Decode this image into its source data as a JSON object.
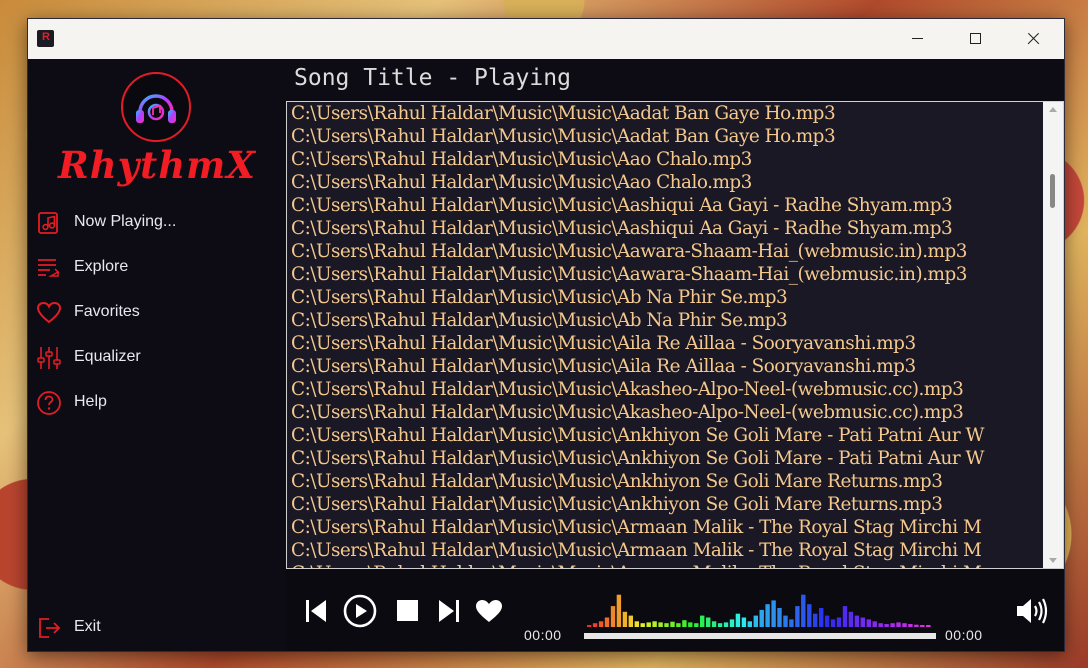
{
  "titlebar": {
    "minimize_glyph": "minimize",
    "maximize_glyph": "maximize",
    "close_glyph": "close"
  },
  "sidebar": {
    "logo_text": "RhythmX",
    "items": [
      {
        "label": "Now Playing...",
        "icon": "music-note-doc-icon"
      },
      {
        "label": "Explore",
        "icon": "playlist-icon"
      },
      {
        "label": "Favorites",
        "icon": "heart-icon"
      },
      {
        "label": "Equalizer",
        "icon": "sliders-icon"
      },
      {
        "label": "Help",
        "icon": "help-icon"
      }
    ],
    "exit_label": "Exit"
  },
  "main": {
    "title": "Song Title - Playing",
    "tracks": [
      "C:\\Users\\Rahul Haldar\\Music\\Music\\Aadat Ban Gaye Ho.mp3",
      "C:\\Users\\Rahul Haldar\\Music\\Music\\Aadat Ban Gaye Ho.mp3",
      "C:\\Users\\Rahul Haldar\\Music\\Music\\Aao Chalo.mp3",
      "C:\\Users\\Rahul Haldar\\Music\\Music\\Aao Chalo.mp3",
      "C:\\Users\\Rahul Haldar\\Music\\Music\\Aashiqui Aa Gayi - Radhe Shyam.mp3",
      "C:\\Users\\Rahul Haldar\\Music\\Music\\Aashiqui Aa Gayi - Radhe Shyam.mp3",
      "C:\\Users\\Rahul Haldar\\Music\\Music\\Aawara-Shaam-Hai_(webmusic.in).mp3",
      "C:\\Users\\Rahul Haldar\\Music\\Music\\Aawara-Shaam-Hai_(webmusic.in).mp3",
      "C:\\Users\\Rahul Haldar\\Music\\Music\\Ab Na Phir Se.mp3",
      "C:\\Users\\Rahul Haldar\\Music\\Music\\Ab Na Phir Se.mp3",
      "C:\\Users\\Rahul Haldar\\Music\\Music\\Aila Re Aillaa - Sooryavanshi.mp3",
      "C:\\Users\\Rahul Haldar\\Music\\Music\\Aila Re Aillaa - Sooryavanshi.mp3",
      "C:\\Users\\Rahul Haldar\\Music\\Music\\Akasheo-Alpo-Neel-(webmusic.cc).mp3",
      "C:\\Users\\Rahul Haldar\\Music\\Music\\Akasheo-Alpo-Neel-(webmusic.cc).mp3",
      "C:\\Users\\Rahul Haldar\\Music\\Music\\Ankhiyon Se Goli Mare - Pati Patni Aur W",
      "C:\\Users\\Rahul Haldar\\Music\\Music\\Ankhiyon Se Goli Mare - Pati Patni Aur W",
      "C:\\Users\\Rahul Haldar\\Music\\Music\\Ankhiyon Se Goli Mare Returns.mp3",
      "C:\\Users\\Rahul Haldar\\Music\\Music\\Ankhiyon Se Goli Mare Returns.mp3",
      "C:\\Users\\Rahul Haldar\\Music\\Music\\Armaan Malik - The Royal Stag Mirchi M",
      "C:\\Users\\Rahul Haldar\\Music\\Music\\Armaan Malik - The Royal Stag Mirchi M",
      "C:\\Users\\Rahul Haldar\\Music\\Music\\Armaan Malik - The Royal Stag Mirchi M"
    ]
  },
  "player": {
    "elapsed": "00:00",
    "duration": "00:00",
    "progress": 0,
    "visualizer_levels": [
      0.05,
      0.1,
      0.15,
      0.25,
      0.55,
      0.85,
      0.4,
      0.3,
      0.15,
      0.1,
      0.12,
      0.15,
      0.12,
      0.1,
      0.14,
      0.1,
      0.18,
      0.12,
      0.1,
      0.3,
      0.25,
      0.15,
      0.1,
      0.12,
      0.2,
      0.35,
      0.25,
      0.15,
      0.3,
      0.45,
      0.6,
      0.7,
      0.5,
      0.3,
      0.2,
      0.55,
      0.85,
      0.6,
      0.35,
      0.5,
      0.3,
      0.2,
      0.25,
      0.55,
      0.4,
      0.3,
      0.25,
      0.2,
      0.15,
      0.1,
      0.08,
      0.1,
      0.12,
      0.1,
      0.08,
      0.06,
      0.05,
      0.04
    ],
    "colors": {
      "accent": "#e31c25",
      "track_text": "#f5c98e"
    }
  }
}
